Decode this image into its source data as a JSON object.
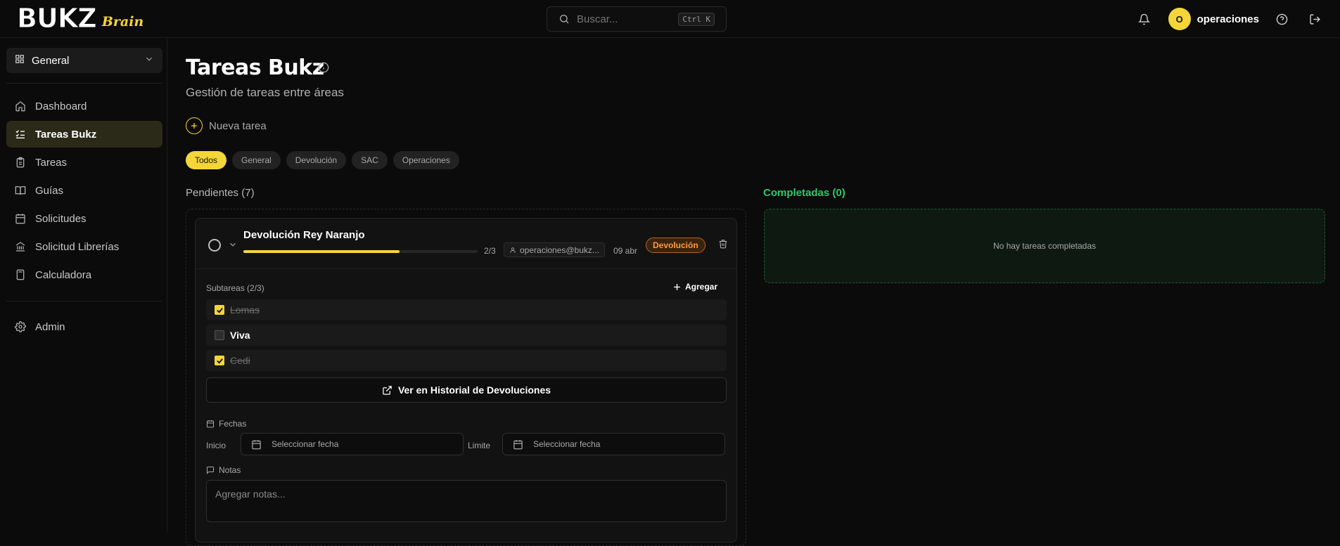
{
  "brand": {
    "main": "BUKZ",
    "sub": "Brain"
  },
  "search": {
    "placeholder": "Buscar...",
    "shortcut": "Ctrl K"
  },
  "user": {
    "initial": "O",
    "name": "operaciones"
  },
  "sidebar": {
    "workspace": "General",
    "items": [
      {
        "label": "Dashboard",
        "icon": "home-icon"
      },
      {
        "label": "Tareas Bukz",
        "icon": "list-checks-icon",
        "active": true
      },
      {
        "label": "Tareas",
        "icon": "clipboard-icon"
      },
      {
        "label": "Guías",
        "icon": "book-open-icon"
      },
      {
        "label": "Solicitudes",
        "icon": "calendar-icon"
      },
      {
        "label": "Solicitud Librerías",
        "icon": "library-icon"
      },
      {
        "label": "Calculadora",
        "icon": "calculator-icon"
      }
    ],
    "admin": {
      "label": "Admin",
      "icon": "gear-icon"
    }
  },
  "page": {
    "title": "Tareas Bukz",
    "subtitle": "Gestión de tareas entre áreas",
    "new_task": "Nueva tarea",
    "filters": [
      "Todos",
      "General",
      "Devolución",
      "SAC",
      "Operaciones"
    ],
    "active_filter": "Todos"
  },
  "columns": {
    "pending_title": "Pendientes (7)",
    "done_title": "Completadas (0)",
    "done_empty": "No hay tareas completadas"
  },
  "task": {
    "title": "Devolución Rey Naranjo",
    "progress": 0.667,
    "progress_text": "2/3",
    "assignee": "operaciones@bukz...",
    "due": "09 abr",
    "tag": "Devolución",
    "subtasks_label": "Subtareas (2/3)",
    "add_label": "Agregar",
    "subtasks": [
      {
        "text": "Lomas",
        "done": true
      },
      {
        "text": "Viva",
        "done": false
      },
      {
        "text": "Cedi",
        "done": true
      }
    ],
    "history_button": "Ver en Historial de Devoluciones",
    "dates_label": "Fechas",
    "start_label": "Inicio",
    "start_placeholder": "Seleccionar fecha",
    "limit_label": "Limite",
    "limit_placeholder": "Seleccionar fecha",
    "notes_label": "Notas",
    "notes_placeholder": "Agregar notas..."
  },
  "colors": {
    "accent": "#f4d639",
    "success": "#31c76a",
    "tag_orange": "#ff9b3a"
  }
}
